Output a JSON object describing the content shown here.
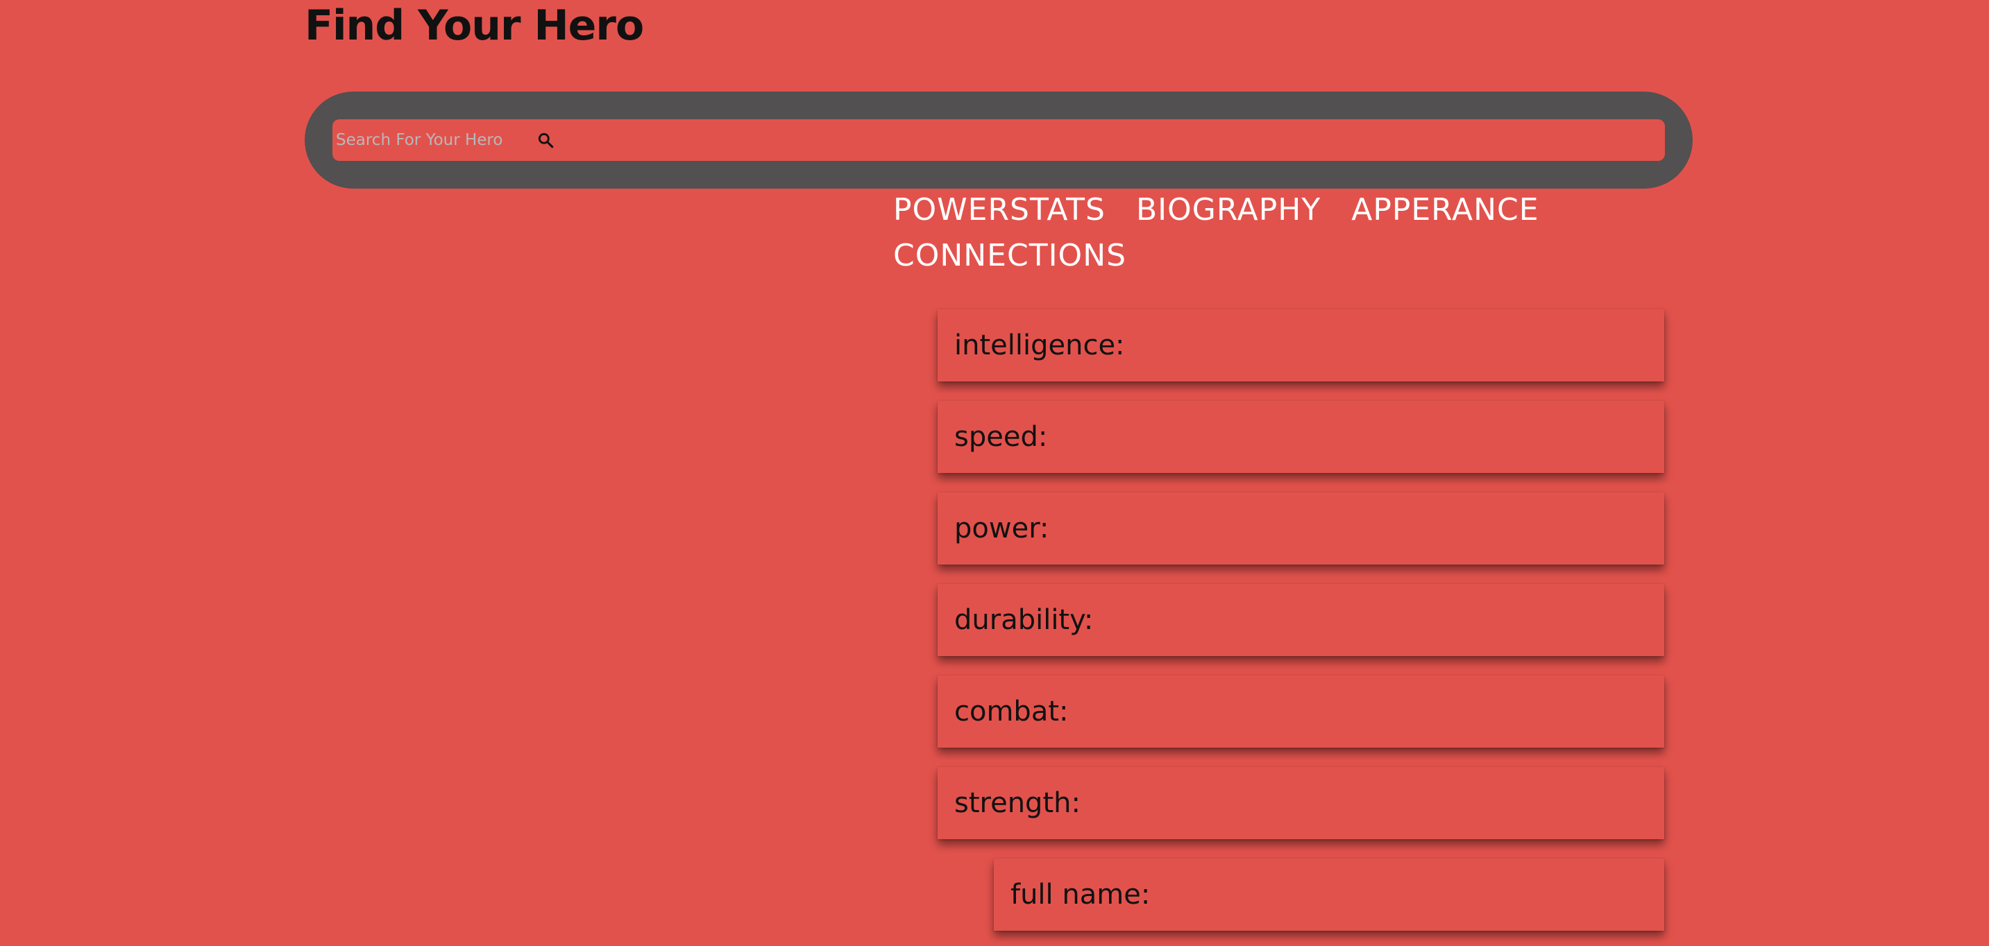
{
  "header": {
    "title": "Find Your Hero"
  },
  "search": {
    "placeholder": "Search For Your Hero",
    "value": "",
    "button_icon": "search-icon"
  },
  "tabs": [
    {
      "label": "POWERSTATS"
    },
    {
      "label": "BIOGRAPHY"
    },
    {
      "label": "APPERANCE"
    },
    {
      "label": "CONNECTIONS"
    }
  ],
  "powerstats": [
    {
      "label": "intelligence:"
    },
    {
      "label": "speed:"
    },
    {
      "label": "power:"
    },
    {
      "label": "durability:"
    },
    {
      "label": "combat:"
    },
    {
      "label": "strength:"
    }
  ],
  "biography": [
    {
      "label": "full name:"
    }
  ],
  "colors": {
    "background": "#e2524c",
    "search_frame": "#525050",
    "tab_text": "#ffffff",
    "title_text": "#111111"
  }
}
